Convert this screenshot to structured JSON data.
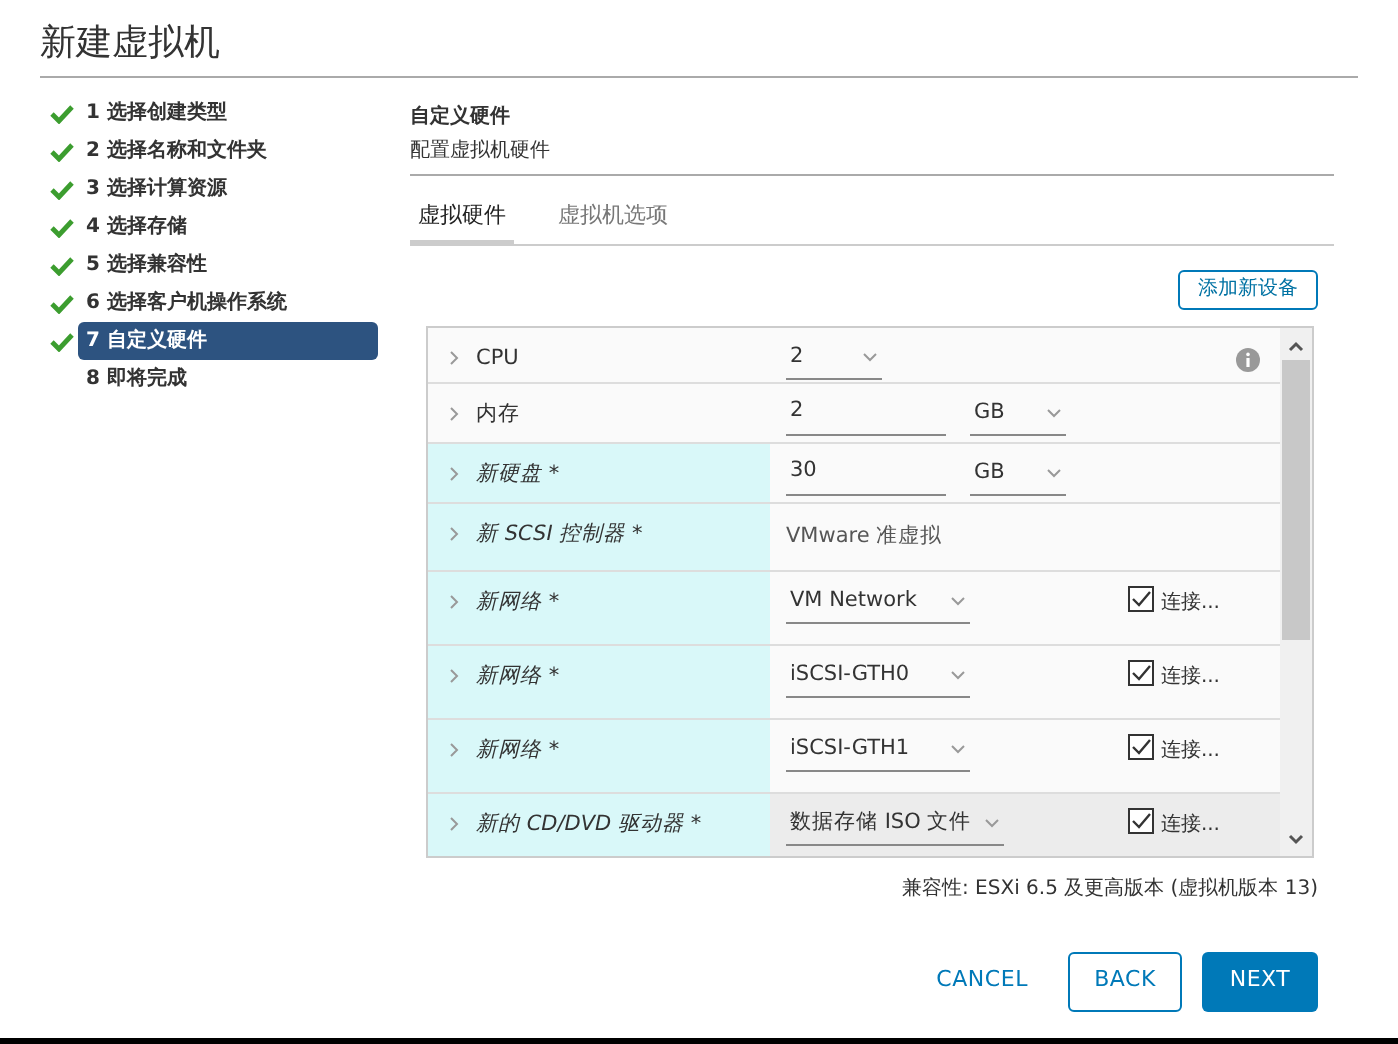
{
  "window": {
    "title": "新建虚拟机"
  },
  "steps": [
    {
      "label": "1 选择创建类型",
      "done": true,
      "selected": false
    },
    {
      "label": "2 选择名称和文件夹",
      "done": true,
      "selected": false
    },
    {
      "label": "3 选择计算资源",
      "done": true,
      "selected": false
    },
    {
      "label": "4 选择存储",
      "done": true,
      "selected": false
    },
    {
      "label": "5 选择兼容性",
      "done": true,
      "selected": false
    },
    {
      "label": "6 选择客户机操作系统",
      "done": true,
      "selected": false
    },
    {
      "label": "7 自定义硬件",
      "done": true,
      "selected": true
    },
    {
      "label": "8 即将完成",
      "done": false,
      "selected": false
    }
  ],
  "header": {
    "title": "自定义硬件",
    "subtitle": "配置虚拟机硬件"
  },
  "tabs": [
    {
      "label": "虚拟硬件",
      "selected": true
    },
    {
      "label": "虚拟机选项",
      "selected": false
    }
  ],
  "add_device_button": "添加新设备",
  "hardware": [
    {
      "label": "CPU",
      "new": false,
      "selected": false,
      "kind": "select",
      "value": "2",
      "info": true
    },
    {
      "label": "内存",
      "new": false,
      "selected": false,
      "kind": "input",
      "value": "2",
      "unit": "GB"
    },
    {
      "label": "新硬盘 *",
      "new": true,
      "selected": false,
      "kind": "input",
      "value": "30",
      "unit": "GB"
    },
    {
      "label": "新 SCSI 控制器 *",
      "new": true,
      "selected": false,
      "kind": "text",
      "value": "VMware 准虚拟"
    },
    {
      "label": "新网络 *",
      "new": true,
      "selected": false,
      "kind": "select",
      "value": "VM Network",
      "connect": {
        "label": "连接...",
        "checked": true
      }
    },
    {
      "label": "新网络 *",
      "new": true,
      "selected": false,
      "kind": "select",
      "value": "iSCSI-GTH0",
      "connect": {
        "label": "连接...",
        "checked": true
      }
    },
    {
      "label": "新网络 *",
      "new": true,
      "selected": false,
      "kind": "select",
      "value": "iSCSI-GTH1",
      "connect": {
        "label": "连接...",
        "checked": true
      }
    },
    {
      "label": "新的 CD/DVD 驱动器 *",
      "new": true,
      "selected": true,
      "kind": "select",
      "value": "数据存储 ISO 文件",
      "connect": {
        "label": "连接...",
        "checked": true
      }
    }
  ],
  "compatibility": "兼容性: ESXi 6.5 及更高版本 (虚拟机版本 13)",
  "buttons": [
    {
      "label": "CANCEL",
      "kind": "flat"
    },
    {
      "label": "BACK",
      "kind": "outline"
    },
    {
      "label": "NEXT",
      "kind": "primary"
    }
  ]
}
